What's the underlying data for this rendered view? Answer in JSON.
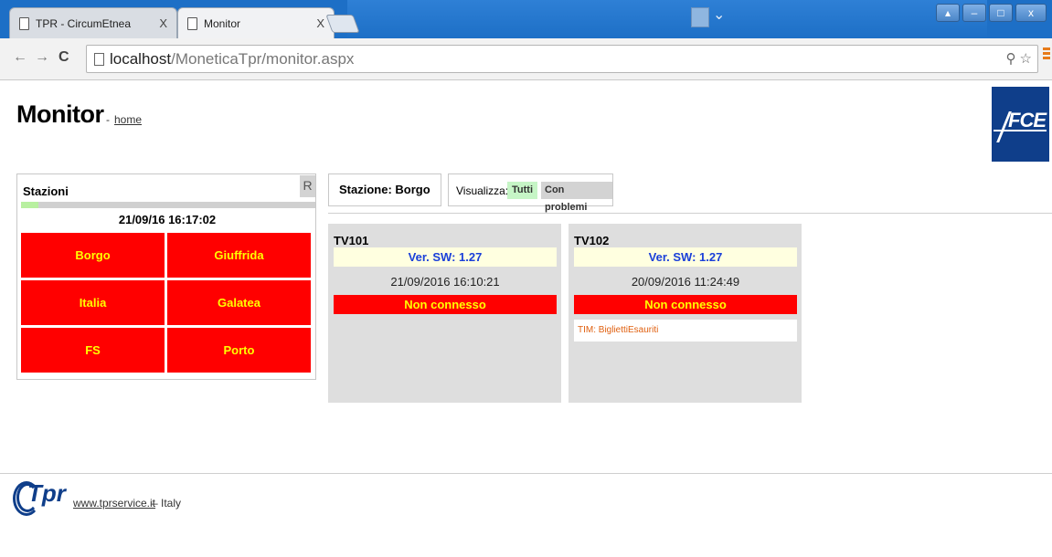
{
  "browser": {
    "tabs": [
      {
        "title": "TPR - CircumEtnea",
        "close": "X",
        "active": false
      },
      {
        "title": "Monitor",
        "close": "X",
        "active": true
      }
    ],
    "url_host": "localhost",
    "url_path": "/MoneticaTpr/monitor.aspx",
    "window_buttons": [
      "▴",
      "–",
      "□",
      "x"
    ]
  },
  "page": {
    "title": "Monitor",
    "separator": "-",
    "home_link": "home",
    "logo_text": "FCE"
  },
  "stazioni": {
    "heading": "Stazioni",
    "refresh_label": "R",
    "progress": 0.06,
    "timestamp": "21/09/16 16:17:02",
    "stations": [
      "Borgo",
      "Giuffrida",
      "Italia",
      "Galatea",
      "FS",
      "Porto"
    ]
  },
  "station_header": {
    "label": "Stazione: Borgo",
    "filter_label": "Visualizza:",
    "filter_all": "Tutti",
    "filter_problems": "Con problemi"
  },
  "devices": [
    {
      "name": "TV101",
      "version": "Ver. SW: 1.27",
      "timestamp": "21/09/2016 16:10:21",
      "status": "Non connesso",
      "alert": ""
    },
    {
      "name": "TV102",
      "version": "Ver. SW: 1.27",
      "timestamp": "20/09/2016 11:24:49",
      "status": "Non connesso",
      "alert": "TIM: BigliettiEsauriti"
    }
  ],
  "footer": {
    "logo_text": "Tpr",
    "link": "www.tprservice.it",
    "suffix": "– Italy"
  },
  "colors": {
    "station_cell_bg": "#ff0000",
    "station_cell_text": "#ffff00",
    "version_text": "#1a3fd9",
    "alert_text": "#e06010",
    "logo_blue": "#0f3e8a"
  }
}
